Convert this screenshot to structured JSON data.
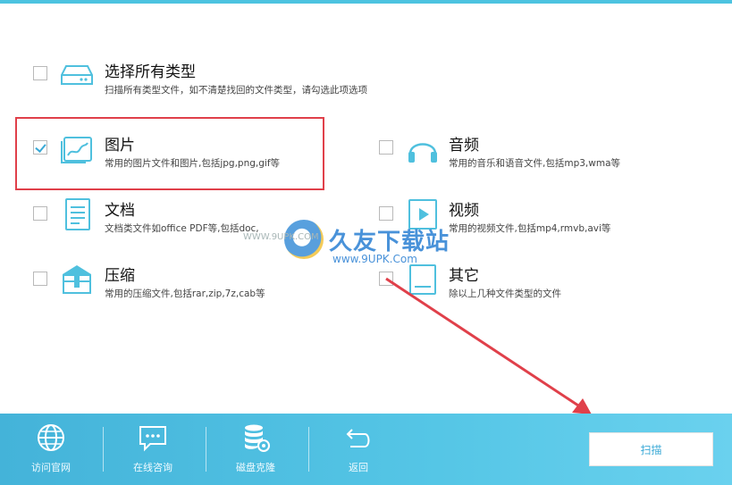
{
  "options": {
    "all": {
      "title": "选择所有类型",
      "desc": "扫描所有类型文件，如不清楚找回的文件类型，请勾选此项选项",
      "checked": false
    },
    "image": {
      "title": "图片",
      "desc": "常用的图片文件和图片,包括jpg,png,gif等",
      "checked": true
    },
    "audio": {
      "title": "音频",
      "desc": "常用的音乐和语音文件,包括mp3,wma等",
      "checked": false
    },
    "doc": {
      "title": "文档",
      "desc": "文档类文件如office PDF等,包括doc,",
      "checked": false
    },
    "video": {
      "title": "视频",
      "desc": "常用的视频文件,包括mp4,rmvb,avi等",
      "checked": false
    },
    "archive": {
      "title": "压缩",
      "desc": "常用的压缩文件,包括rar,zip,7z,cab等",
      "checked": false
    },
    "other": {
      "title": "其它",
      "desc": "除以上几种文件类型的文件",
      "checked": false
    }
  },
  "watermark": {
    "name": "久友下载站",
    "url": "www.9UPK.Com",
    "url2": "WWW.9UPK.COM"
  },
  "bottom_bar": {
    "visit_site": "访问官网",
    "online_consult": "在线咨询",
    "disk_clone": "磁盘克隆",
    "back": "返回"
  },
  "scan_button": "扫描",
  "colors": {
    "accent": "#4cc3e0",
    "highlight": "#e0404a",
    "bar": "#4fbfe2"
  }
}
